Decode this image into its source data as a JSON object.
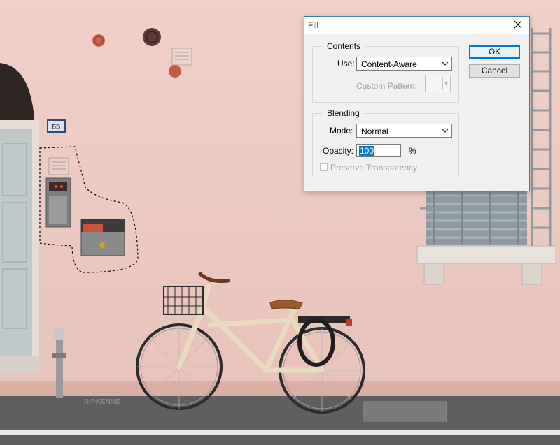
{
  "photo": {
    "house_number": "65",
    "wall_color": "#eccbc2",
    "street_text": "RIPKENNE"
  },
  "dialog": {
    "title": "Fill",
    "close_icon": "close-icon",
    "contents": {
      "legend": "Contents",
      "use_label": "Use:",
      "use_value": "Content-Aware",
      "custom_pattern_label": "Custom Pattern:"
    },
    "blending": {
      "legend": "Blending",
      "mode_label": "Mode:",
      "mode_value": "Normal",
      "opacity_label": "Opacity:",
      "opacity_value": "100",
      "opacity_unit": "%",
      "preserve_label": "Preserve Transparency",
      "preserve_checked": false
    },
    "ok_label": "OK",
    "cancel_label": "Cancel",
    "accent_color": "#0078d7"
  }
}
